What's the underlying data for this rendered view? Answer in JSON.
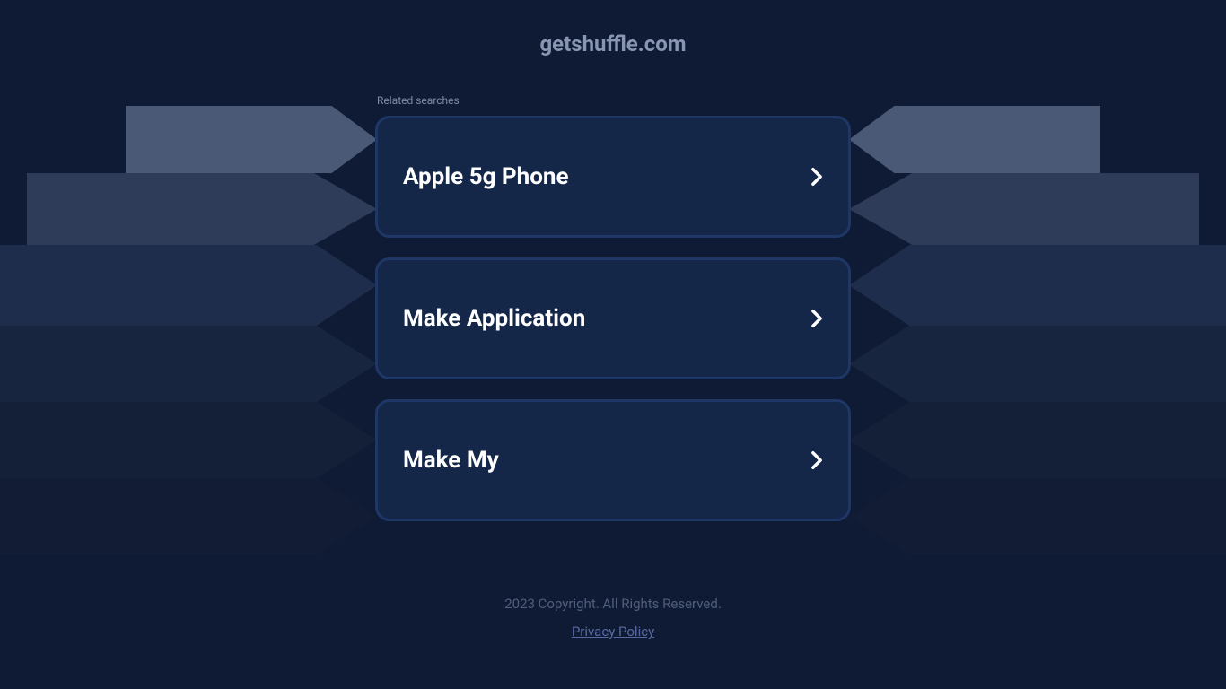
{
  "domain_title": "getshuffle.com",
  "related_label": "Related searches",
  "search_links": [
    {
      "label": "Apple 5g Phone"
    },
    {
      "label": "Make Application"
    },
    {
      "label": "Make My"
    }
  ],
  "footer": {
    "copyright": "2023 Copyright. All Rights Reserved.",
    "privacy_link": "Privacy Policy"
  }
}
